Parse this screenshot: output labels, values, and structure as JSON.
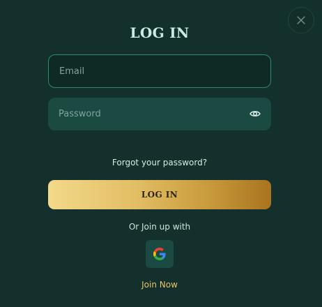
{
  "modal": {
    "title": "LOG IN",
    "close_icon": "close-icon"
  },
  "form": {
    "email_placeholder": "Email",
    "password_placeholder": "Password",
    "eye_icon": "eye-icon",
    "forgot_label": "Forgot your password?",
    "submit_label": "LOG IN"
  },
  "social": {
    "or_text": "Or Join up with",
    "google_icon": "google-icon"
  },
  "footer": {
    "join_label": "Join Now"
  },
  "colors": {
    "background": "#14302c",
    "accent_gold": "#e2bd63",
    "input_border": "#2e8a76",
    "link_gold": "#e7c46a"
  }
}
